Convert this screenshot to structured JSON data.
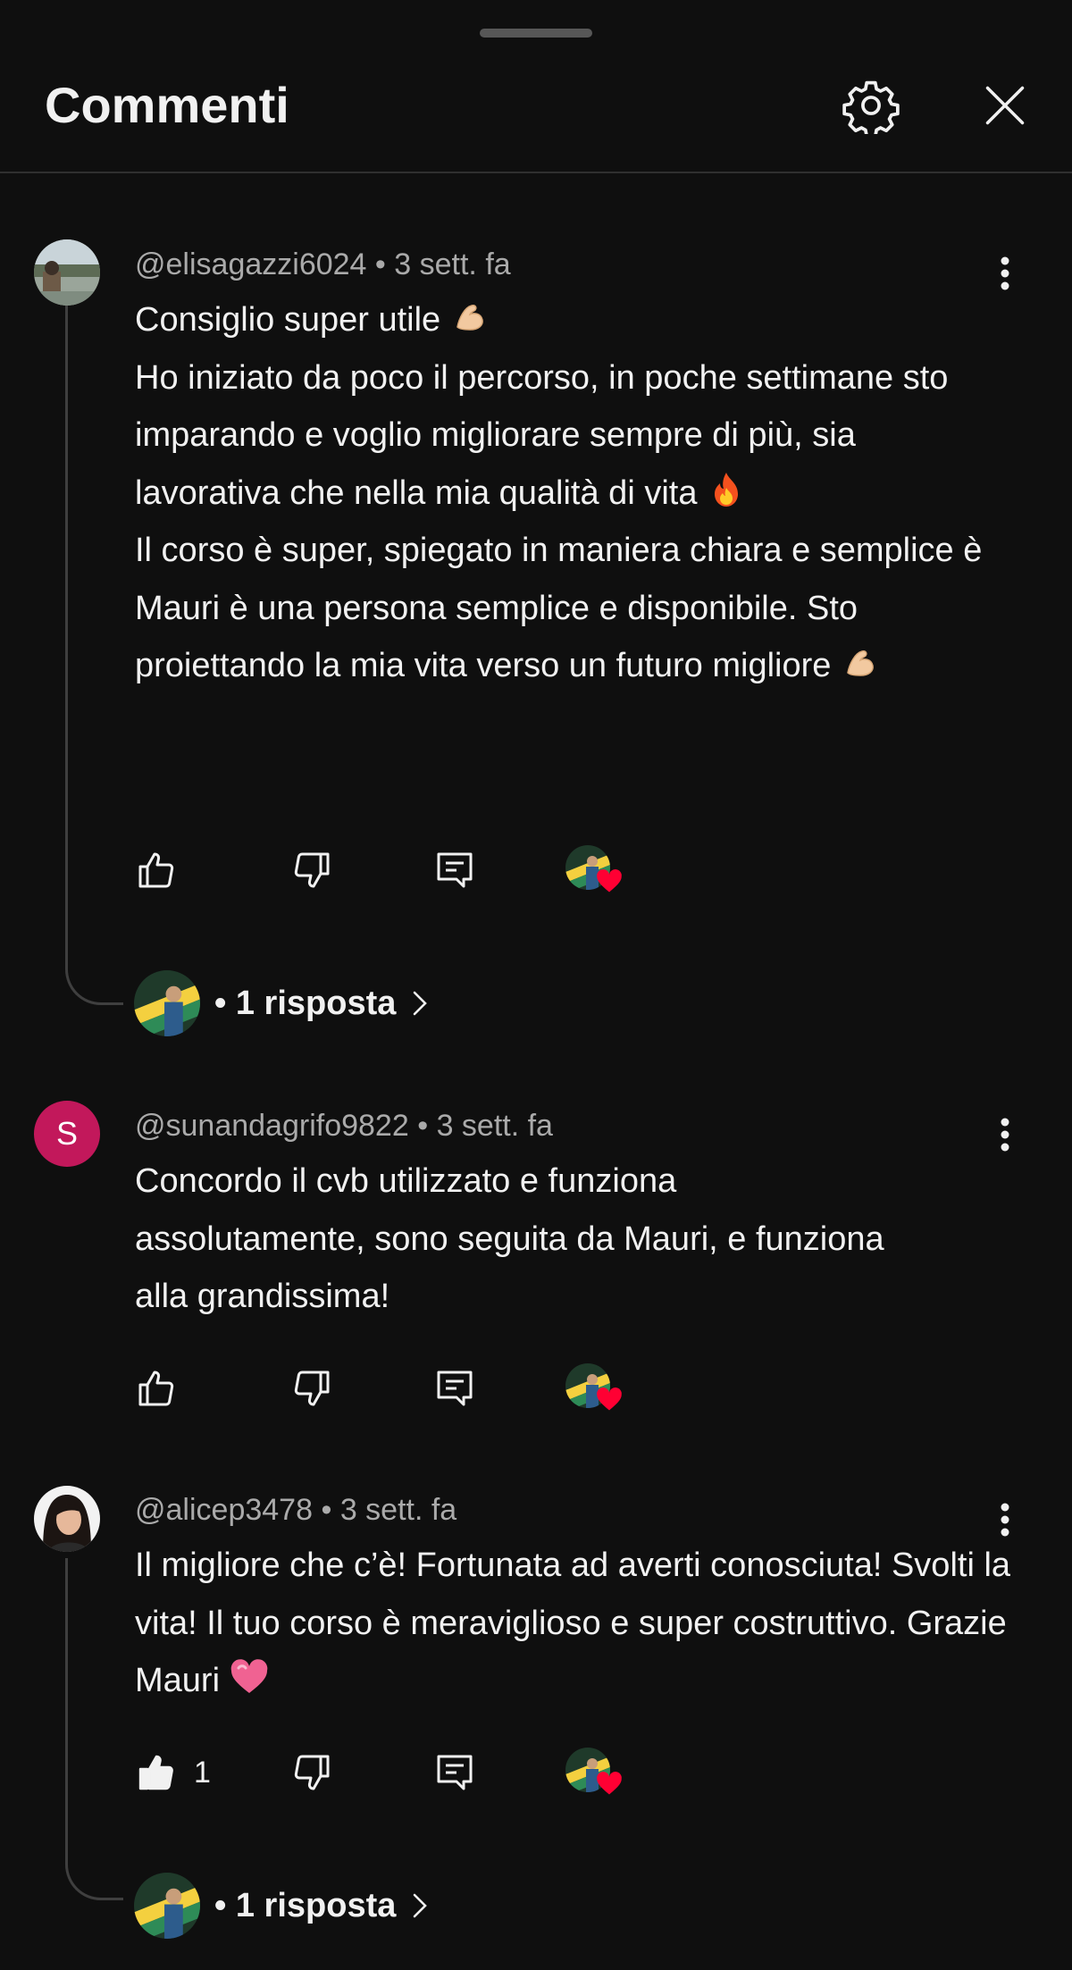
{
  "header": {
    "title": "Commenti",
    "settings_icon": "gear-icon",
    "close_icon": "close-icon"
  },
  "comments": [
    {
      "author": "@elisagazzi6024",
      "time": "3 sett. fa",
      "lines": [
        "Consiglio super utile",
        "Ho iniziato da poco il percorso, in poche settimane sto imparando e voglio migliorare sempre di più, sia lavorativa che nella mia qualità di vita",
        "Il corso è super, spiegato in maniera chiara e semplice è Mauri è una persona semplice e disponibile. Sto proiettando la mia vita verso un futuro migliore"
      ],
      "emojis": [
        "flexed-biceps-emoji",
        "fire-emoji",
        "flexed-biceps-emoji"
      ],
      "like_count": "",
      "liked": false,
      "creator_heart": true,
      "replies_label": "• 1 risposta"
    },
    {
      "author": "@sunandagrifo9822",
      "time": "3 sett. fa",
      "avatar_letter": "S",
      "avatar_color": "#c2185b",
      "lines": [
        "Concordo il cvb utilizzato e funziona assolutamente, sono seguita da Mauri, e funziona alla grandissima!"
      ],
      "like_count": "",
      "liked": false,
      "creator_heart": true,
      "replies_label": ""
    },
    {
      "author": "@alicep3478",
      "time": "3 sett. fa",
      "lines": [
        "Il migliore che c’è! Fortunata ad averti conosciuta! Svolti la vita! Il tuo corso è meraviglioso e super costruttivo. Grazie Mauri"
      ],
      "emojis": [
        "pink-heart-emoji"
      ],
      "like_count": "1",
      "liked": true,
      "creator_heart": true,
      "replies_label": "• 1 risposta"
    }
  ],
  "colors": {
    "background": "#0f0f0f",
    "text": "#f1f1f1",
    "meta": "#aaaaaa",
    "heart": "#ff0033",
    "divider": "#2f2f2f"
  }
}
